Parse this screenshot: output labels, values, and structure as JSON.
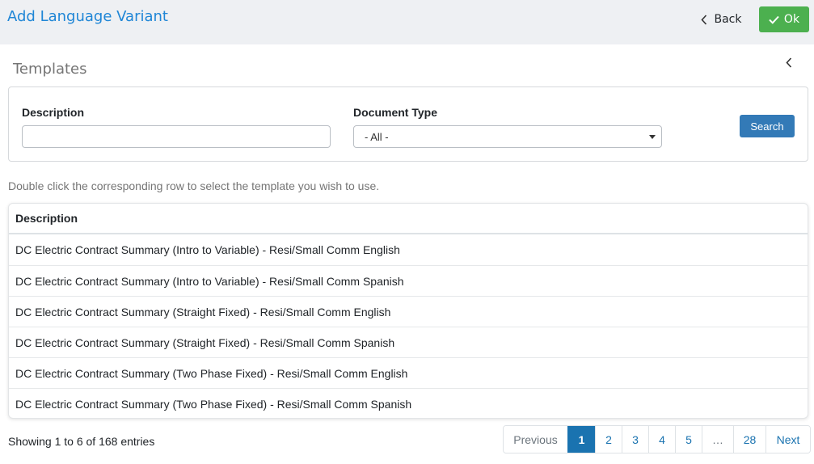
{
  "header": {
    "title": "Add Language Variant",
    "back_label": "Back",
    "ok_label": "Ok"
  },
  "section": {
    "title": "Templates"
  },
  "filters": {
    "description_label": "Description",
    "description_value": "",
    "document_type_label": "Document Type",
    "document_type_value": "- All -",
    "search_label": "Search"
  },
  "hint": "Double click the corresponding row to select the template you wish to use.",
  "table": {
    "column": "Description",
    "rows": [
      "DC Electric Contract Summary (Intro to Variable) - Resi/Small Comm English",
      "DC Electric Contract Summary (Intro to Variable) - Resi/Small Comm Spanish",
      "DC Electric Contract Summary (Straight Fixed) - Resi/Small Comm English",
      "DC Electric Contract Summary (Straight Fixed) - Resi/Small Comm Spanish",
      "DC Electric Contract Summary (Two Phase Fixed) - Resi/Small Comm English",
      "DC Electric Contract Summary (Two Phase Fixed) - Resi/Small Comm Spanish"
    ]
  },
  "pagination": {
    "info": "Showing 1 to 6 of 168 entries",
    "previous": "Previous",
    "pages": [
      "1",
      "2",
      "3",
      "4",
      "5",
      "…",
      "28"
    ],
    "next": "Next"
  },
  "colors": {
    "title_blue": "#1f86d6",
    "ok_green": "#4cb04f",
    "search_blue": "#337ab7",
    "page_active": "#1a73b0"
  }
}
